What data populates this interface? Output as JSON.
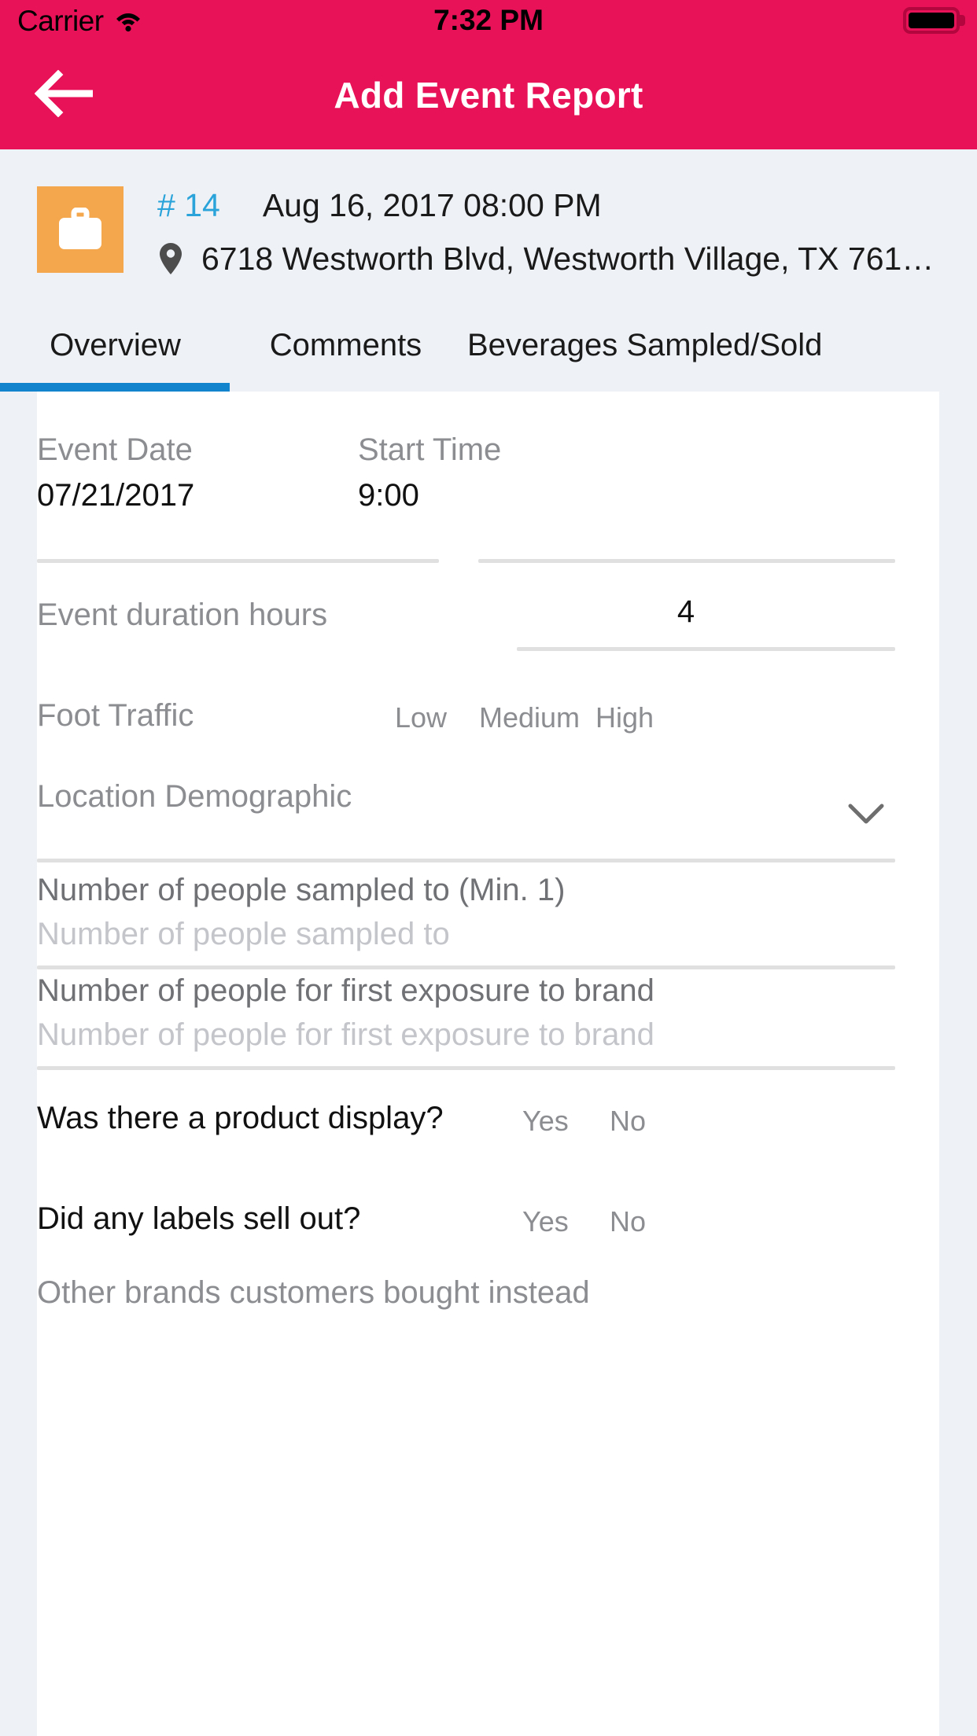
{
  "status_bar": {
    "carrier": "Carrier",
    "time": "7:32 PM",
    "wifi_icon": "wifi-icon",
    "battery_icon": "battery-full-icon"
  },
  "nav": {
    "back_icon": "arrow-left-icon",
    "title": "Add Event Report"
  },
  "event_header": {
    "icon": "briefcase-icon",
    "icon_bg": "#f5a74e",
    "number": "# 14",
    "number_color": "#29a3d9",
    "datetime": "Aug 16, 2017 08:00 PM",
    "location_icon": "map-pin-icon",
    "address": "6718 Westworth Blvd, Westworth Village, TX 761…"
  },
  "tabs": {
    "active_index": 0,
    "indicator_color": "#1283cd",
    "items": [
      {
        "label": "Overview"
      },
      {
        "label": "Comments"
      },
      {
        "label": "Beverages Sampled/Sold"
      }
    ]
  },
  "form": {
    "event_date": {
      "label": "Event Date",
      "value": "07/21/2017"
    },
    "start_time": {
      "label": "Start Time",
      "value": "9:00"
    },
    "duration": {
      "label": "Event duration hours",
      "value": "4"
    },
    "foot_traffic": {
      "label": "Foot Traffic",
      "options": [
        "Low",
        "Medium",
        "High"
      ]
    },
    "location_demographic": {
      "label": "Location Demographic",
      "value": "",
      "chevron_icon": "chevron-down-icon"
    },
    "people_sampled": {
      "label": "Number of people sampled to (Min. 1)",
      "placeholder": "Number of people sampled to",
      "value": ""
    },
    "first_exposure": {
      "label": "Number of people for first exposure to brand",
      "placeholder": "Number of people for first exposure to brand",
      "value": ""
    },
    "product_display": {
      "question": "Was there a product display?",
      "options": [
        "Yes",
        "No"
      ]
    },
    "labels_sold_out": {
      "question": "Did any labels sell out?",
      "options": [
        "Yes",
        "No"
      ]
    },
    "other_brands": {
      "label": "Other brands customers bought instead",
      "value": ""
    }
  },
  "theme": {
    "header_pink": "#e81258",
    "page_bg": "#eef1f6",
    "card_bg": "#ffffff",
    "label_gray": "#8b8d91",
    "placeholder_gray": "#c3c5ca",
    "rule_gray": "#e0e0e0"
  }
}
